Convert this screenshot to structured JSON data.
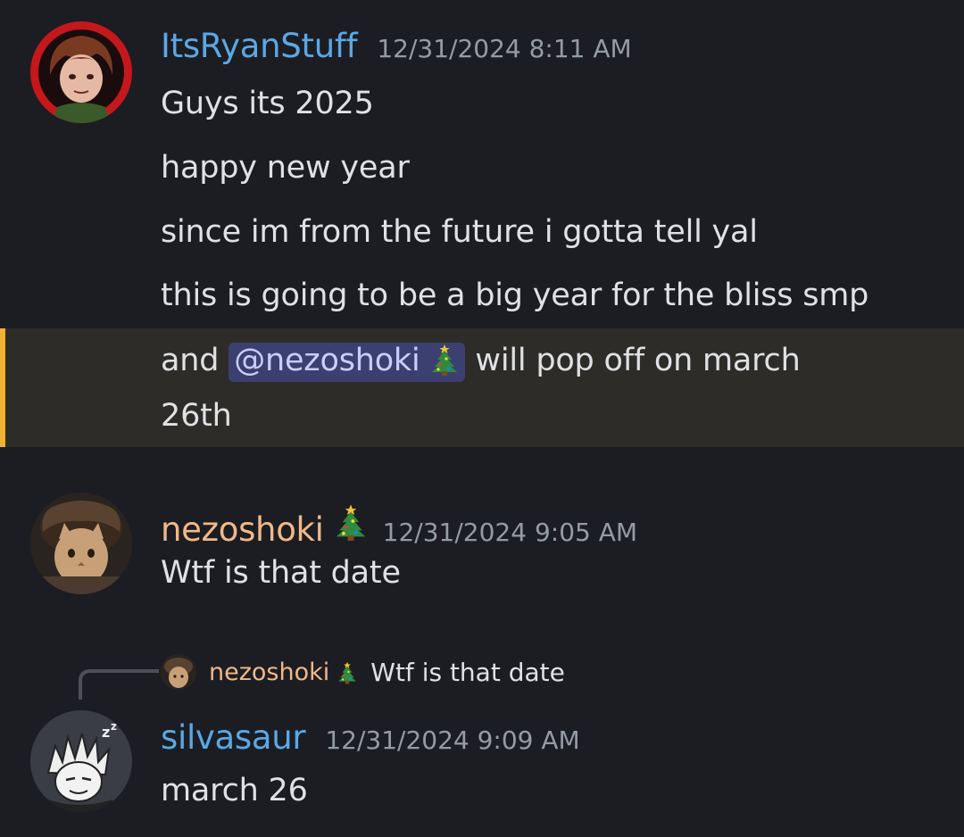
{
  "messages": [
    {
      "username": "ItsRyanStuff",
      "username_color": "#5aa8e6",
      "timestamp": "12/31/2024 8:11 AM",
      "lines": [
        "Guys its 2025",
        "happy new year",
        "since im from the future i gotta tell yal",
        "this is going to be a big year for the bliss smp"
      ],
      "highlighted_line": {
        "before": "and",
        "mention": "@nezoshoki",
        "mention_emoji": "christmas-tree",
        "after": "will pop off on march",
        "continuation": "26th"
      }
    },
    {
      "username": "nezoshoki",
      "username_emoji": "christmas-tree",
      "username_color": "#f0b88a",
      "timestamp": "12/31/2024 9:05 AM",
      "lines": [
        "Wtf is that date"
      ]
    },
    {
      "reply": {
        "username": "nezoshoki",
        "emoji": "christmas-tree",
        "text": "Wtf is that date"
      },
      "username": "silvasaur",
      "username_color": "#5aa8e6",
      "timestamp": "12/31/2024 9:09 AM",
      "lines": [
        "march 26"
      ]
    }
  ],
  "colors": {
    "background": "#1c1d22",
    "highlight_background": "#2e2c28",
    "highlight_bar": "#f0b232",
    "mention_background": "#3c4070",
    "mention_text": "#c9cdfb",
    "timestamp": "#949ba4"
  }
}
